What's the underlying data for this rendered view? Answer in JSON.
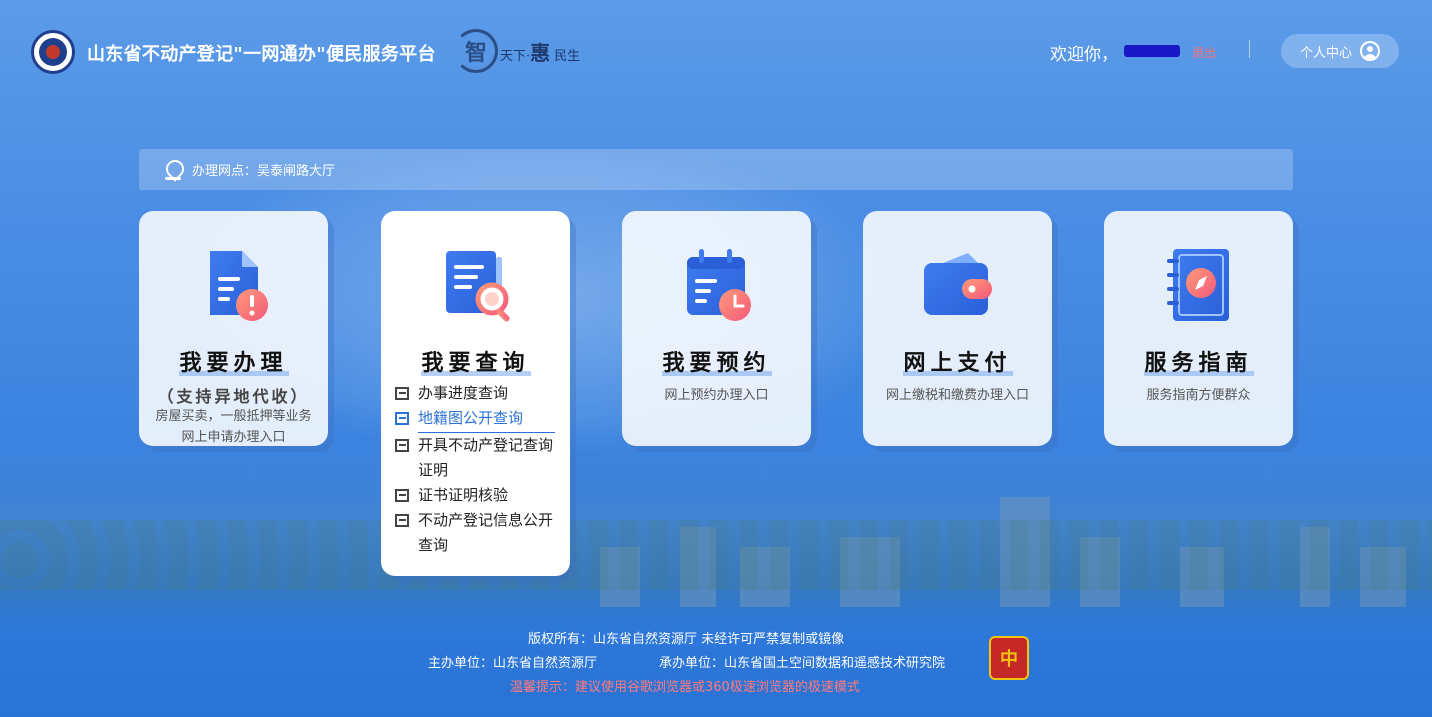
{
  "header": {
    "site_title": "山东省不动产登记\"一网通办\"便民服务平台",
    "slogan_mark": "智",
    "slogan_a": "天下·",
    "slogan_b": "惠",
    "slogan_c": "民生",
    "welcome_prefix": "欢迎你，",
    "logout_label": "退出",
    "user_center_label": "个人中心"
  },
  "location": {
    "label": "办理网点：吴泰闸路大厅"
  },
  "cards": [
    {
      "title": "我要办理",
      "subtitle": "（支持异地代收）",
      "desc": "房屋买卖，一般抵押等业务网上申请办理入口"
    },
    {
      "title": "我要查询",
      "items": [
        {
          "label": "办事进度查询"
        },
        {
          "label": "地籍图公开查询"
        },
        {
          "label": "开具不动产登记查询证明"
        },
        {
          "label": "证书证明核验"
        },
        {
          "label": "不动产登记信息公开查询"
        }
      ]
    },
    {
      "title": "我要预约",
      "desc": "网上预约办理入口"
    },
    {
      "title": "网上支付",
      "desc": "网上缴税和缴费办理入口"
    },
    {
      "title": "服务指南",
      "desc": "服务指南方便群众"
    }
  ],
  "footer": {
    "copyright": "版权所有：山东省自然资源厅 未经许可严禁复制或镜像",
    "host": "主办单位：山东省自然资源厅",
    "organizer": "承办单位：山东省国土空间数据和遥感技术研究院",
    "tip": "温馨提示：建议使用谷歌浏览器或360极速浏览器的极速模式",
    "badge_text": "中"
  },
  "colors": {
    "accent_blue": "#2a72d5",
    "logout_red": "#ff7070",
    "tip_red": "#ff7a7a"
  },
  "icons": {
    "logo": "provincial-emblem-icon",
    "pin": "location-pin-icon",
    "user": "user-avatar-icon",
    "card_1": "document-warning-icon",
    "card_2": "document-search-icon",
    "card_3": "calendar-clock-icon",
    "card_4": "wallet-icon",
    "card_5": "compass-guidebook-icon",
    "badge": "party-government-badge-icon"
  }
}
